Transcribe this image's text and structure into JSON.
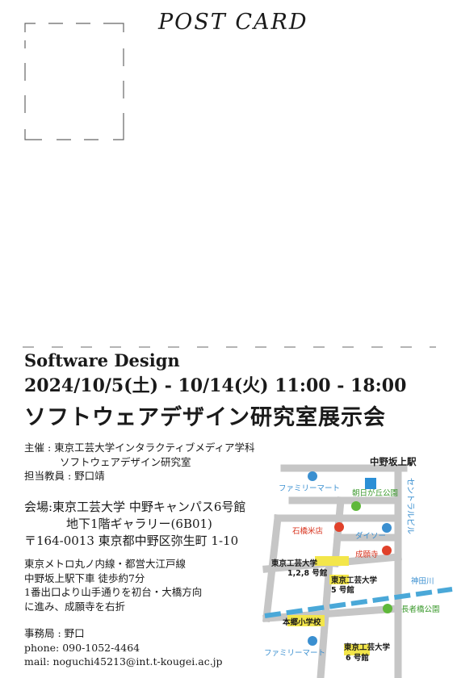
{
  "postcard": {
    "title": "POST CARD"
  },
  "event": {
    "brand": "Software Design",
    "dates": "2024/10/5(土) - 10/14(火)  11:00 - 18:00",
    "headline": "ソフトウェアデザイン研究室展示会"
  },
  "organizer": {
    "line1": "主催 : 東京工芸大学インタラクティブメディア学科",
    "line2": "ソフトウェアデザイン研究室",
    "teacher": "担当教員 : 野口靖"
  },
  "venue": {
    "line1": "会場:東京工芸大学 中野キャンパス6号館",
    "line2": "地下1階ギャラリー(6B01)",
    "address": "〒164-0013 東京都中野区弥生町 1-10"
  },
  "access": {
    "line1": "東京メトロ丸ノ内線・都営大江戸線",
    "line2": "中野坂上駅下車 徒歩約7分",
    "line3": "1番出口より山手通りを初台・大橋方向",
    "line4": "に進み、成願寺を右折"
  },
  "office": {
    "label": "事務局 : 野口",
    "phone": "phone: 090-1052-4464",
    "mail": "mail: noguchi45213@int.t-kougei.ac.jp"
  },
  "map": {
    "station": "中野坂上駅",
    "central_building": "セントラルビル",
    "familymart_top": "ファミリーマート",
    "asahigaoka_park": "朝日が丘公園",
    "ishibashi_rice": "石橋米店",
    "daiso": "ダイソー",
    "jouganji": "成願寺",
    "kanda_river": "神田川",
    "chojabashi_park": "長者橋公園",
    "building_128_line1": "東京工芸大学",
    "building_128_line2": "1,2,8 号館",
    "building_5_line1": "東京工芸大学",
    "building_5_line2": "5 号館",
    "hongo_school": "本郷小学校",
    "familymart_bottom": "ファミリーマート",
    "building_6_line1": "東京工芸大学",
    "building_6_line2": "6 号館",
    "colors": {
      "road": "#c6c6c6",
      "river": "#4aa8d8",
      "label_blue": "#3a8fd0",
      "label_green": "#3c9a2e",
      "label_red": "#d8331e",
      "highlight": "#f3e64a",
      "dot_blue": "#3a8fd0",
      "dot_green": "#5fb83a",
      "dot_red": "#e0412a",
      "station_square": "#2b8fd6"
    }
  }
}
